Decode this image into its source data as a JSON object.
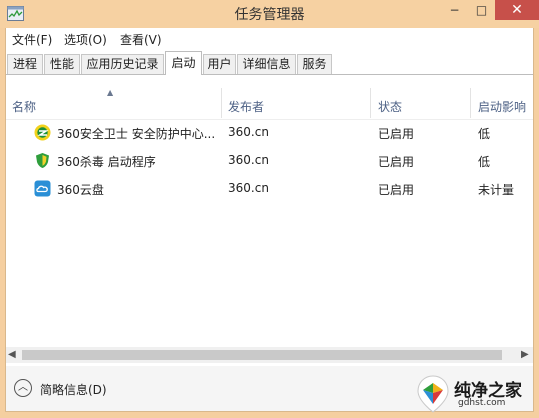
{
  "window": {
    "title": "任务管理器",
    "controls": {
      "minimize": "−",
      "maximize": "□",
      "close": "✕"
    }
  },
  "menu": [
    "文件(F)",
    "选项(O)",
    "查看(V)"
  ],
  "tabs": [
    "进程",
    "性能",
    "应用历史记录",
    "启动",
    "用户",
    "详细信息",
    "服务"
  ],
  "active_tab": "启动",
  "columns": [
    "名称",
    "发布者",
    "状态",
    "启动影响"
  ],
  "rows": [
    {
      "icon": "360-safeguard-icon",
      "name": "360安全卫士 安全防护中心...",
      "publisher": "360.cn",
      "status": "已启用",
      "impact": "低"
    },
    {
      "icon": "360-antivirus-icon",
      "name": "360杀毒 启动程序",
      "publisher": "360.cn",
      "status": "已启用",
      "impact": "低"
    },
    {
      "icon": "360-cloud-icon",
      "name": "360云盘",
      "publisher": "360.cn",
      "status": "已启用",
      "impact": "未计量"
    }
  ],
  "footer": {
    "label": "简略信息(D)"
  },
  "watermark": {
    "name": "纯净之家",
    "url": "gdhst.com"
  },
  "colors": {
    "title_bar": "#f6d1a2",
    "close_button": "#c7504a",
    "header_text": "#4d6185"
  }
}
